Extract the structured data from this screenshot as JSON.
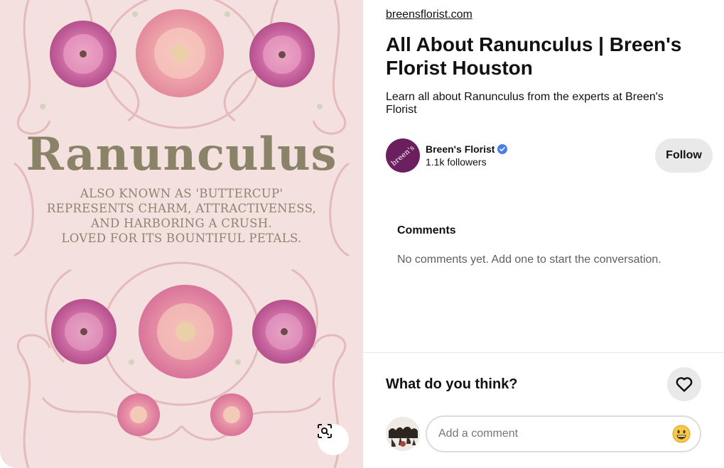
{
  "pin": {
    "image_title": "Ranunculus",
    "image_lines": [
      "ALSO KNOWN AS 'BUTTERCUP'",
      "REPRESENTS CHARM, ATTRACTIVENESS,",
      "AND HARBORING A CRUSH.",
      "LOVED FOR ITS BOUNTIFUL PETALS."
    ],
    "lens_icon": "visual-search-icon"
  },
  "details": {
    "source": "breensflorist.com",
    "title": "All About Ranunculus | Breen's Florist Houston",
    "description": "Learn all about Ranunculus from the experts at Breen's Florist"
  },
  "creator": {
    "avatar_text": "breen's",
    "name": "Breen's Florist",
    "verified_icon": "verified-badge-icon",
    "followers": "1.1k followers",
    "follow_label": "Follow"
  },
  "comments": {
    "heading": "Comments",
    "empty_text": "No comments yet. Add one to start the conversation."
  },
  "footer": {
    "prompt": "What do you think?",
    "like_icon": "heart-outline-icon",
    "comment_placeholder": "Add a comment",
    "emoji_icon": "smiley-emoji-icon"
  },
  "colors": {
    "image_background": "#f3e0df",
    "title_text": "#8a8368",
    "avatar_purple": "#6b1f5e",
    "verified_blue": "#4a7ee8",
    "button_gray": "#e9e9e9"
  }
}
